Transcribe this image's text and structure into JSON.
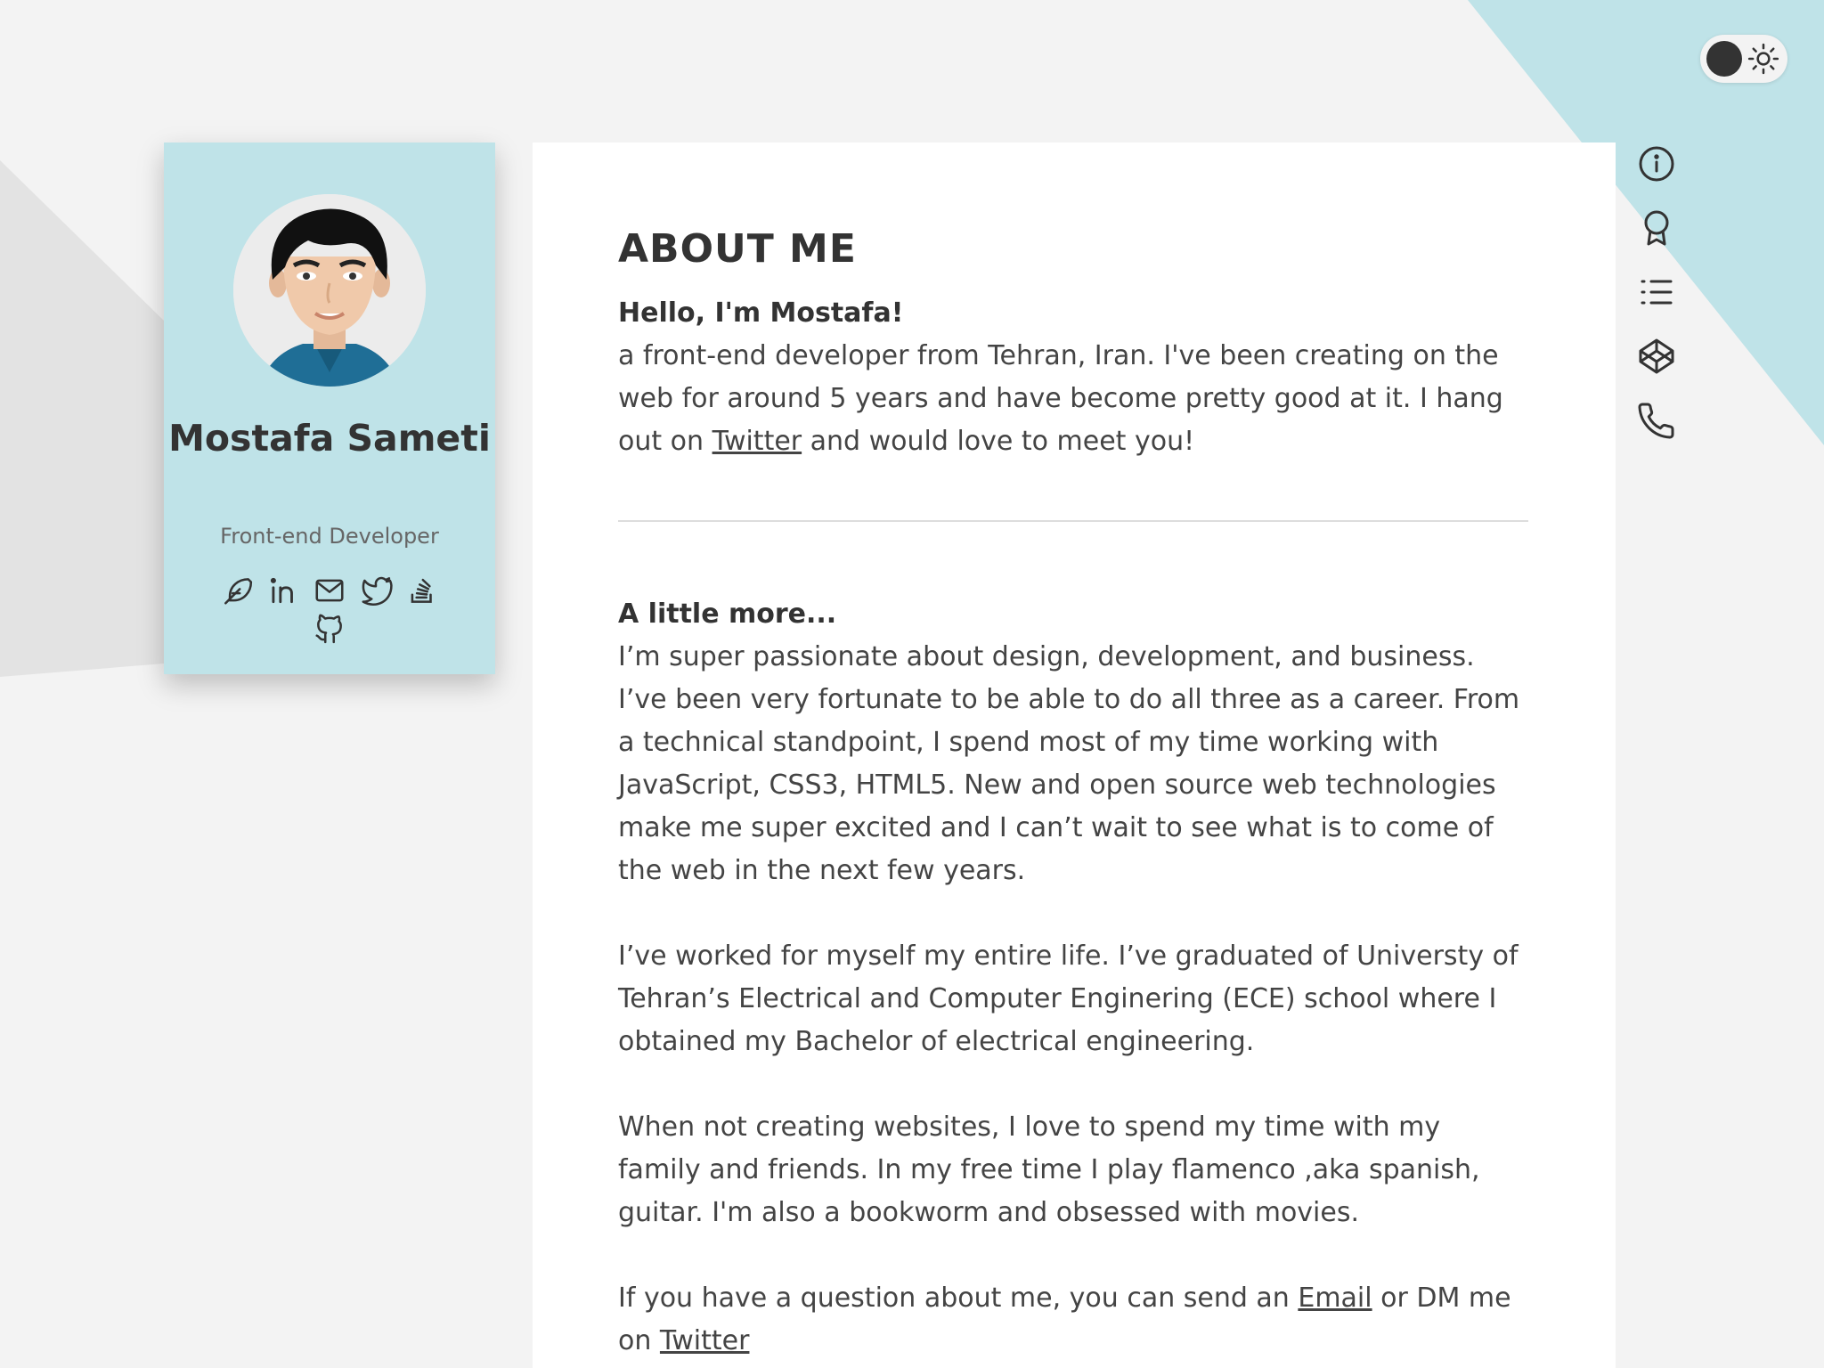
{
  "profile": {
    "name": "Mostafa Sameti",
    "role": "Front-end Developer",
    "social_icons": [
      "feather-icon",
      "linkedin-icon",
      "mail-icon",
      "twitter-icon",
      "stackoverflow-icon",
      "github-icon"
    ]
  },
  "theme_toggle": {
    "knob_color": "#333333",
    "icon": "sun-icon"
  },
  "side_nav": {
    "items": [
      "info-icon",
      "award-icon",
      "list-icon",
      "codepen-icon",
      "phone-icon"
    ]
  },
  "about": {
    "title": "ABOUT ME",
    "greeting": "Hello, I'm Mostafa!",
    "intro_before_link": "a front-end developer from Tehran, Iran. I've been creating on the web for around 5 years and have become pretty good at it. I hang out on ",
    "intro_link": "Twitter",
    "intro_after_link": " and would love to meet you!",
    "more_heading": "A little more...",
    "para1": "I’m super passionate about design, development, and business. I’ve been very fortunate to be able to do all three as a career. From a technical standpoint, I spend most of my time working with JavaScript, CSS3, HTML5. New and open source web technologies make me super excited and I can’t wait to see what is to come of the web in the next few years.",
    "para2": "I’ve worked for myself my entire life. I’ve graduated of Universty of Tehran’s Electrical and Computer Enginering (ECE) school where I obtained my Bachelor of electrical engineering.",
    "para3": "When not creating websites, I love to spend my time with my family and friends. In my free time I play flamenco ,aka spanish, guitar. I'm also a bookworm and obsessed with movies.",
    "contact_before_email": "If you have a question about me, you can send an ",
    "contact_email_link": "Email",
    "contact_middle": " or DM me on ",
    "contact_twitter_link": "Twitter"
  },
  "colors": {
    "background": "#f3f3f3",
    "accent": "#bfe3e8",
    "text": "#333333"
  }
}
